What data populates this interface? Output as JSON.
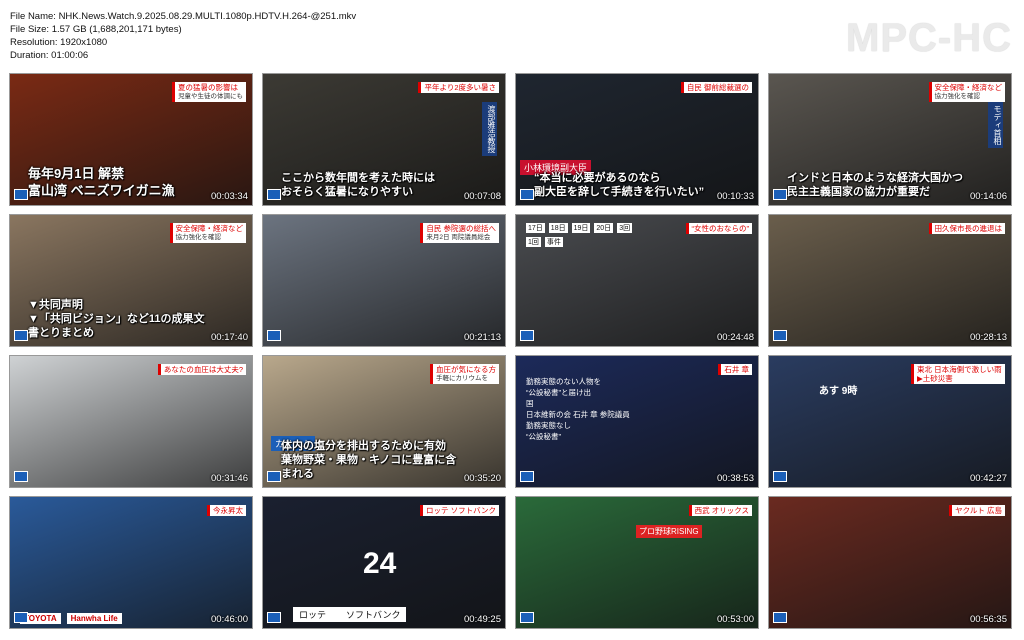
{
  "file_info": {
    "name": "File Name: NHK.News.Watch.9.2025.08.29.MULTI.1080p.HDTV.H.264-@251.mkv",
    "size": "File Size: 1.57 GB (1,688,201,171 bytes)",
    "resolution": "Resolution: 1920x1080",
    "duration": "Duration: 01:00:06"
  },
  "logo": "MPC-HC",
  "thumbnails": [
    {
      "time": "00:03:34",
      "caption_line1": "毎年9月1日 解禁",
      "caption_line2": "富山湾 ベニズワイガニ漁",
      "tag": "夏の猛暑の影響は",
      "tag_sub": "児童や生徒の体調にも",
      "bg": "#7a2a14"
    },
    {
      "time": "00:07:08",
      "caption_line1": "ここから数年間を考えた時には",
      "caption_line2": "おそらく猛暑になりやすい",
      "tag": "平年より2度多い暑さ",
      "tag_sub": "",
      "vtag": "渡部雅浩教授",
      "bg": "#3c3a34"
    },
    {
      "time": "00:10:33",
      "caption_line1": "“本当に必要があるのなら",
      "caption_line2": "副大臣を辞して手続きを行いたい”",
      "tag": "自民 御前総裁選の",
      "tag_sub": "",
      "name_label": "小林環境副大臣",
      "bg": "#1f2630"
    },
    {
      "time": "00:14:06",
      "caption_line1": "インドと日本のような経済大国かつ",
      "caption_line2": "民主主義国家の協力が重要だ",
      "tag": "安全保障・経済など",
      "tag_sub": "協力強化を確認",
      "vtag": "モディ首相",
      "bg": "#5a5650"
    },
    {
      "time": "00:17:40",
      "caption_line1": "▼共同声明",
      "caption_line2": "▼「共同ビジョン」など11の成果文書とりまとめ",
      "tag": "安全保障・経済など",
      "tag_sub": "協力強化を確認",
      "bg": "#8a7660"
    },
    {
      "time": "00:21:13",
      "caption_line1": "",
      "caption_line2": "",
      "tag": "自民 参院選の総括へ",
      "tag_sub": "来月2日 両院議員総会",
      "bg": "#6c7480"
    },
    {
      "time": "00:24:48",
      "caption_line1": "",
      "caption_line2": "",
      "tag": "“女性のおならの”",
      "tag_sub": "",
      "timeline": [
        "17日",
        "18日",
        "19日",
        "20日",
        "3回",
        "1回",
        "事件"
      ],
      "bg": "#4a4c50"
    },
    {
      "time": "00:28:13",
      "caption_line1": "",
      "caption_line2": "",
      "tag": "田久保市長の進退は",
      "tag_sub": "",
      "bg": "#6a5e4c"
    },
    {
      "time": "00:31:46",
      "caption_line1": "",
      "caption_line2": "",
      "tag": "あなたの血圧は大丈夫?",
      "tag_sub": "",
      "bg": "#cfd2d4"
    },
    {
      "time": "00:35:20",
      "caption_line1": "体内の塩分を排出するために有効",
      "caption_line2": "葉物野菜・果物・キノコに豊富に含まれる",
      "label": "カリウム",
      "tag": "血圧が気になる方",
      "tag_sub": "手軽にカリウムを",
      "bg": "#b9a88c"
    },
    {
      "time": "00:38:53",
      "caption_line1": "",
      "caption_line2": "",
      "tag": "石井 章",
      "tag_sub": "",
      "diagram_text": [
        "勤務実態のない人物を",
        "“公設秘書”と届け出",
        "国",
        "日本維新の会 石井 章 参院議員",
        "勤務実態なし",
        "“公設秘書”"
      ],
      "bg": "#1c2a5a"
    },
    {
      "time": "00:42:27",
      "caption_line1": "",
      "caption_line2": "",
      "tag": "東北 日本海側で激しい雨 ▶土砂災害",
      "tag_sub": "",
      "map_label": "あす 9時",
      "bg": "#2a3c60"
    },
    {
      "time": "00:46:00",
      "caption_line1": "",
      "caption_line2": "",
      "tag": "今永昇太",
      "tag_sub": "",
      "ads": [
        "TOYOTA",
        "Hanwha Life"
      ],
      "bg": "#2a5a9a"
    },
    {
      "time": "00:49:25",
      "caption_line1": "",
      "caption_line2": "",
      "tag": "ロッテ ソフトバンク",
      "tag_sub": "",
      "jersey": "24",
      "score": [
        "ロッテ",
        "ソフトバンク"
      ],
      "bg": "#1a2030"
    },
    {
      "time": "00:53:00",
      "caption_line1": "",
      "caption_line2": "",
      "tag": "西武 オリックス",
      "tag_sub": "",
      "banner": "プロ野球RISING",
      "bg": "#2a6a3a"
    },
    {
      "time": "00:56:35",
      "caption_line1": "",
      "caption_line2": "",
      "tag": "ヤクルト 広島",
      "tag_sub": "",
      "bg": "#6a2a20"
    }
  ]
}
